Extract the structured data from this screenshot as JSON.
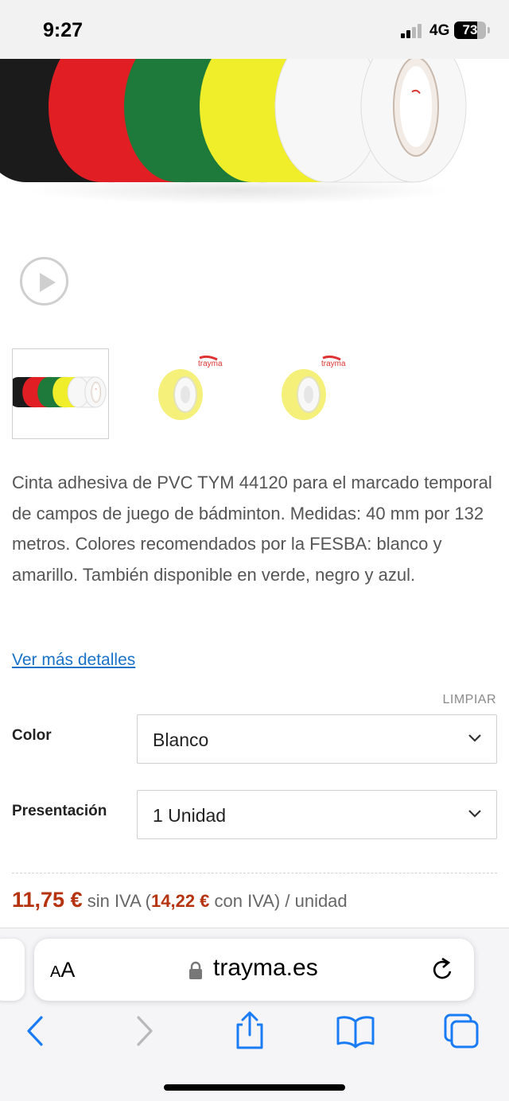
{
  "status_bar": {
    "time": "9:27",
    "network": "4G",
    "battery": "73",
    "battery_level": 0.73
  },
  "hero": {
    "tape_colors": [
      "#1b1b1b",
      "#e01e24",
      "#1d7a3a",
      "#f0ee2a",
      "#f7f7f7"
    ]
  },
  "thumbnails": [
    {
      "kind": "multi-color-tapes",
      "active": true
    },
    {
      "kind": "yellow-tape",
      "brand": "trayma",
      "active": false
    },
    {
      "kind": "yellow-tape",
      "brand": "trayma",
      "active": false
    }
  ],
  "product": {
    "description": "Cinta adhesiva de PVC TYM 44120 para el marcado temporal de campos de juego de bádminton. Medidas: 40 mm por 132 metros. Colores recomendados por la FESBA: blanco y amarillo. También disponible en verde, negro y azul.",
    "more_details": "Ver más detalles"
  },
  "options": {
    "clear": "LIMPIAR",
    "color": {
      "label": "Color",
      "value": "Blanco"
    },
    "presentation": {
      "label": "Presentación",
      "value": "1 Unidad"
    }
  },
  "price": {
    "net": "11,75 €",
    "net_suffix": " sin IVA (",
    "gross": "14,22 €",
    "gross_suffix": " con IVA) / unidad"
  },
  "browser": {
    "aa_small": "A",
    "aa_big": "A",
    "url": "trayma.es"
  },
  "colors": {
    "price_red": "#b5330e",
    "link_blue": "#1a73c9",
    "ios_blue": "#1a7cf5"
  }
}
